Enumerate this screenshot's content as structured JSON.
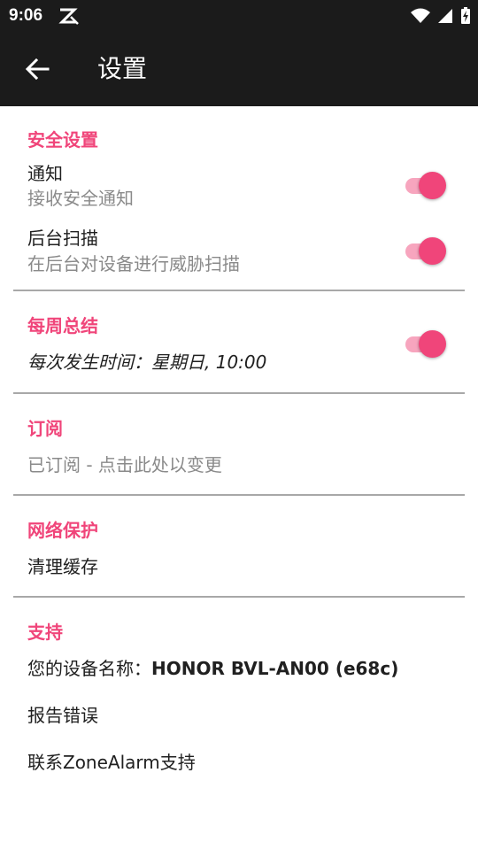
{
  "status_bar": {
    "time": "9:06"
  },
  "app_bar": {
    "title": "设置"
  },
  "security": {
    "header": "安全设置",
    "notify": {
      "title": "通知",
      "subtitle": "接收安全通知",
      "enabled": true
    },
    "scan": {
      "title": "后台扫描",
      "subtitle": "在后台对设备进行威胁扫描",
      "enabled": true
    }
  },
  "weekly": {
    "header": "每周总结",
    "subtitle": "每次发生时间：星期日, 10:00",
    "enabled": true
  },
  "subscription": {
    "header": "订阅",
    "subtitle": "已订阅 - 点击此处以变更"
  },
  "network": {
    "header": "网络保护",
    "clear_cache": "清理缓存"
  },
  "support": {
    "header": "支持",
    "device_label": "您的设备名称：",
    "device_name": "HONOR BVL-AN00 (e68c)",
    "report_bug": "报告错误",
    "contact": "联系ZoneAlarm支持"
  },
  "colors": {
    "accent": "#f0457a",
    "bar": "#1b1b1b"
  },
  "icons": [
    "zonealarm-icon",
    "wifi-icon",
    "signal-icon",
    "battery-icon",
    "back-arrow-icon"
  ]
}
